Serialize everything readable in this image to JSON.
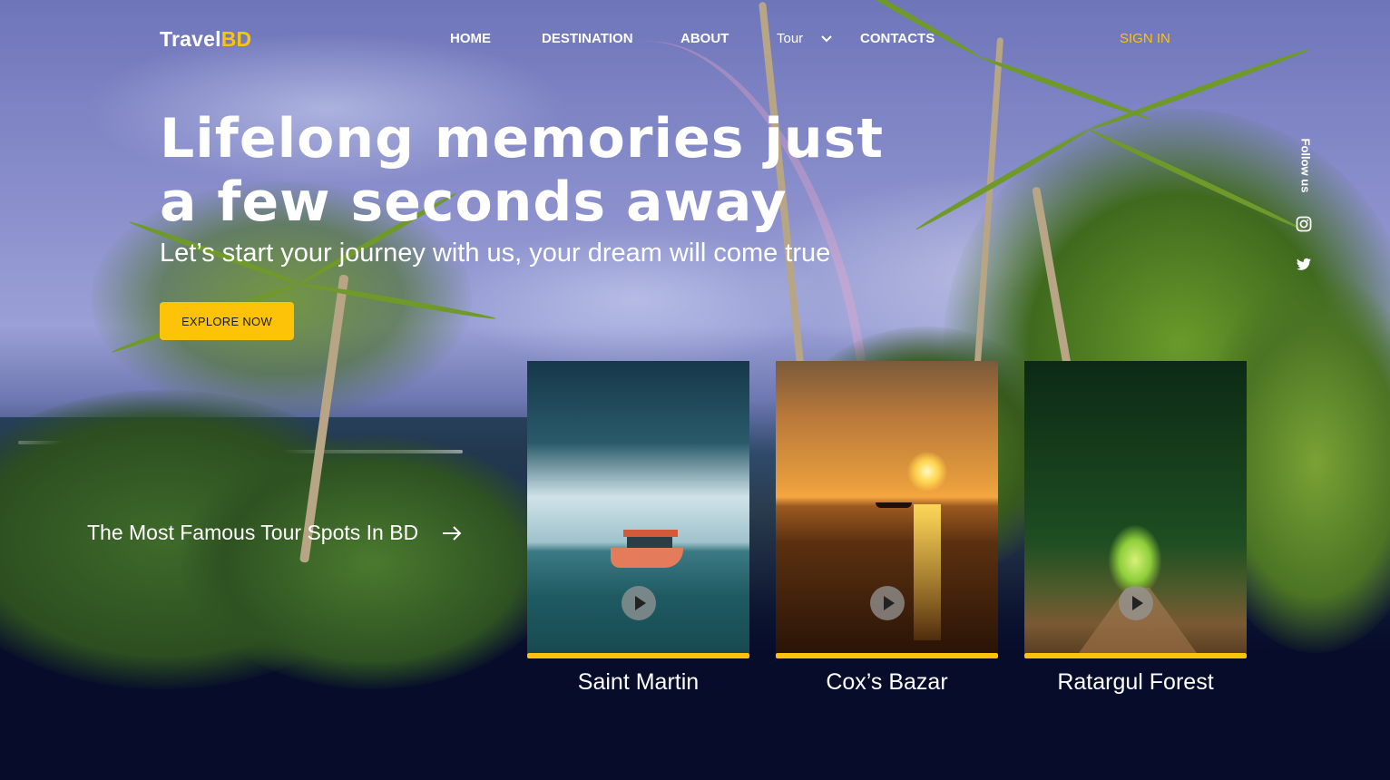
{
  "brand": {
    "logo_prefix": "Travel",
    "logo_accent": "BD"
  },
  "nav": {
    "home": "HOME",
    "destination": "DESTINATION",
    "about": "ABOUT",
    "tour": "Tour",
    "contacts": "CONTACTS",
    "signin": "SIGN IN"
  },
  "hero": {
    "headline": "Lifelong memories just a few seconds away",
    "subhead": "Let’s start your journey with us, your dream will come true",
    "cta": "EXPLORE NOW"
  },
  "social": {
    "follow_label": "Follow us",
    "icons": [
      "instagram-icon",
      "twitter-icon"
    ]
  },
  "spots": {
    "title": "The Most Famous Tour Spots In BD",
    "cards": [
      {
        "label": "Saint Martin"
      },
      {
        "label": "Cox’s Bazar"
      },
      {
        "label": "Ratargul Forest"
      }
    ]
  },
  "colors": {
    "accent": "#fdc308",
    "background": "#060c2a",
    "text": "#ffffff"
  }
}
